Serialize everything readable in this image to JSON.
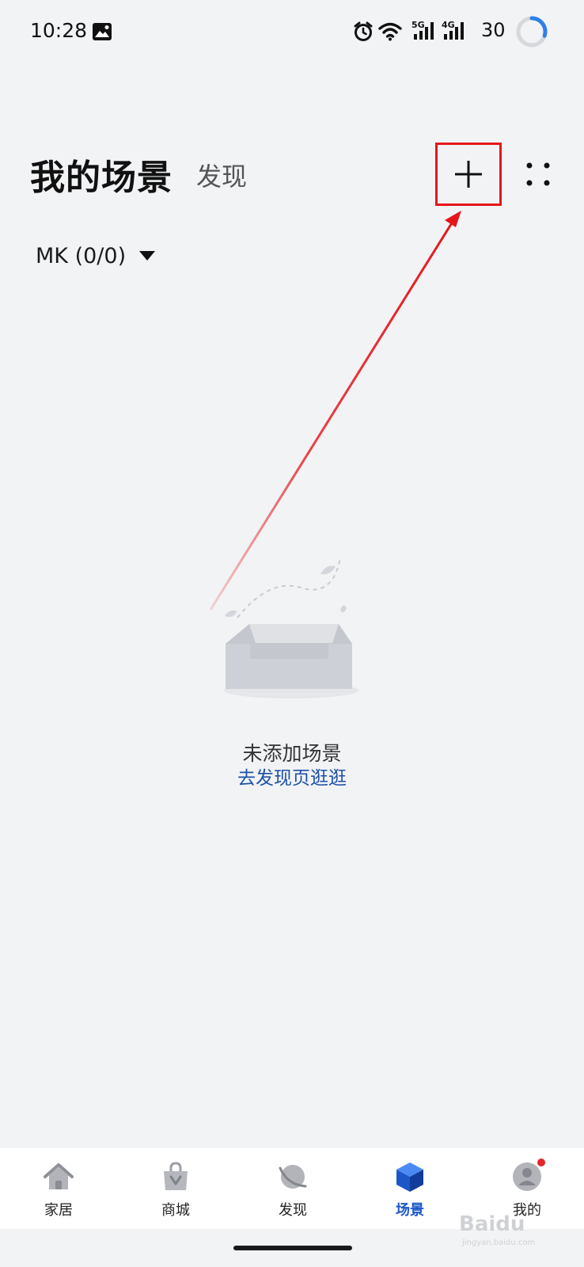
{
  "status_bar": {
    "time": "10:28",
    "network_5g": "5G",
    "network_4g": "4G",
    "battery": "30",
    "icons": [
      "gallery-notification-icon",
      "alarm-icon",
      "wifi-icon",
      "signal-5g-icon",
      "signal-4g-icon",
      "battery-ring-icon"
    ]
  },
  "header": {
    "title": "我的场景",
    "discover_tab": "发现",
    "add_icon": "plus-icon",
    "more_icon": "four-dot-grid-icon"
  },
  "home_selector": {
    "label": "MK (0/0)",
    "icon": "triangle-down-icon"
  },
  "empty_state": {
    "title": "未添加场景",
    "link": "去发现页逛逛",
    "illustration": "empty-inbox-illustration"
  },
  "bottom_nav": {
    "items": [
      {
        "label": "家居",
        "icon": "home-icon",
        "active": false
      },
      {
        "label": "商城",
        "icon": "shopping-bag-icon",
        "active": false
      },
      {
        "label": "发现",
        "icon": "planet-icon",
        "active": false
      },
      {
        "label": "场景",
        "icon": "cube-icon",
        "active": true
      },
      {
        "label": "我的",
        "icon": "user-avatar-icon",
        "active": false,
        "badge": true
      }
    ]
  },
  "colors": {
    "background": "#f2f3f5",
    "accent": "#1d56c8",
    "link": "#1d51a8",
    "annotation": "#e4161b",
    "badge": "#e5262a"
  },
  "watermark": {
    "brand": "Baidu",
    "subtitle": "jingyan.baidu.com"
  }
}
